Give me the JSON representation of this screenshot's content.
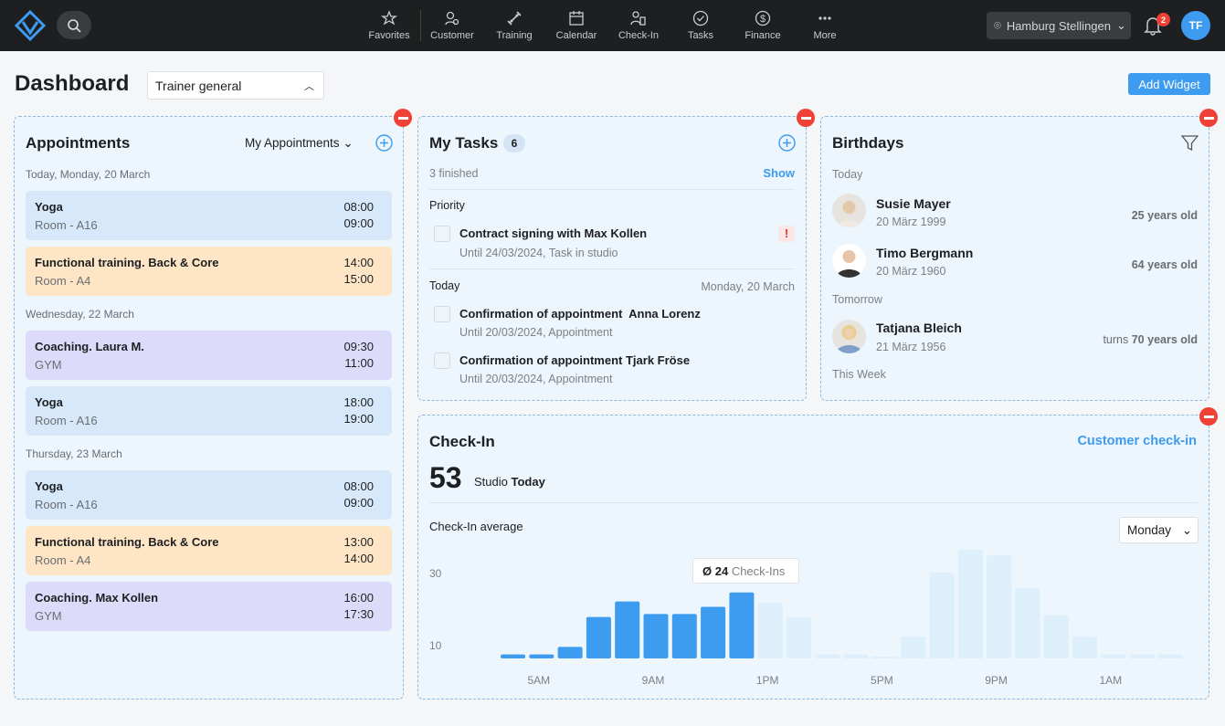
{
  "nav": {
    "items": [
      {
        "label": "Favorites",
        "icon": "star-icon"
      },
      {
        "label": "Customer",
        "icon": "customer-icon"
      },
      {
        "label": "Training",
        "icon": "dumbbell-icon"
      },
      {
        "label": "Calendar",
        "icon": "calendar-icon"
      },
      {
        "label": "Check-In",
        "icon": "checkin-icon"
      },
      {
        "label": "Tasks",
        "icon": "check-circle-icon"
      },
      {
        "label": "Finance",
        "icon": "dollar-icon"
      },
      {
        "label": "More",
        "icon": "more-icon"
      }
    ],
    "location": "Hamburg Stellingen",
    "notifications": "2",
    "user_initials": "TF"
  },
  "page": {
    "title": "Dashboard",
    "view_select": "Trainer general",
    "add_widget": "Add Widget"
  },
  "appointments": {
    "title": "Appointments",
    "filter": "My Appointments",
    "days": [
      {
        "label": "Today, Monday, 20 March",
        "items": [
          {
            "name": "Yoga",
            "room": "Room - A16",
            "start": "08:00",
            "end": "09:00",
            "color": "#d6e8fa"
          },
          {
            "name": "Functional training. Back & Core",
            "room": "Room - A4",
            "start": "14:00",
            "end": "15:00",
            "color": "#fde5c6"
          }
        ]
      },
      {
        "label": "Wednesday, 22 March",
        "items": [
          {
            "name": "Coaching. Laura M.",
            "room": "GYM",
            "start": "09:30",
            "end": "11:00",
            "color": "#dcdcfa"
          },
          {
            "name": "Yoga",
            "room": "Room - A16",
            "start": "18:00",
            "end": "19:00",
            "color": "#d6e8fa"
          }
        ]
      },
      {
        "label": "Thursday, 23 March",
        "items": [
          {
            "name": "Yoga",
            "room": "Room - A16",
            "start": "08:00",
            "end": "09:00",
            "color": "#d6e8fa"
          },
          {
            "name": "Functional training. Back & Core",
            "room": "Room - A4",
            "start": "13:00",
            "end": "14:00",
            "color": "#fde5c6"
          },
          {
            "name": "Coaching. Max Kollen",
            "room": "GYM",
            "start": "16:00",
            "end": "17:30",
            "color": "#dcdcfa"
          }
        ]
      }
    ]
  },
  "tasks": {
    "title": "My Tasks",
    "count": "6",
    "finished": "3 finished",
    "show": "Show",
    "priority_label": "Priority",
    "priority": [
      {
        "name": "Contract signing with Max Kollen",
        "sub": "Until 24/03/2024, Task in studio",
        "flag": "!"
      }
    ],
    "today_label": "Today",
    "today_date": "Monday, 20 March",
    "today": [
      {
        "name": "Confirmation of appointment  Anna Lorenz",
        "sub": "Until 20/03/2024, Appointment"
      },
      {
        "name": "Confirmation of appointment Tjark Fröse",
        "sub": "Until 20/03/2024, Appointment"
      }
    ]
  },
  "birthdays": {
    "title": "Birthdays",
    "today_label": "Today",
    "tomorrow_label": "Tomorrow",
    "week_label": "This Week",
    "people": [
      {
        "name": "Susie Mayer",
        "date": "20 März 1999",
        "age": "25 years old"
      },
      {
        "name": "Timo Bergmann",
        "date": "20 März 1960",
        "age": "64 years old"
      },
      {
        "name": "Tatjana Bleich",
        "date": "21 März 1956",
        "age_prefix": "turns",
        "age": "70 years old"
      }
    ]
  },
  "checkin": {
    "title": "Check-In",
    "link": "Customer check-in",
    "count": "53",
    "studio": "Studio",
    "today": "Today",
    "avg_label": "Check-In average",
    "day_select": "Monday",
    "tooltip_value": "Ø 24",
    "tooltip_label": "Check-Ins"
  },
  "chart_data": {
    "type": "bar",
    "title": "Check-In average",
    "ymin": 6.5,
    "yticks": [
      10,
      30
    ],
    "ytick_labels": [
      "10",
      "30"
    ],
    "categories": [
      "4AM",
      "5AM",
      "6AM",
      "7AM",
      "8AM",
      "9AM",
      "10AM",
      "11AM",
      "12PM",
      "1PM",
      "2PM",
      "3PM",
      "4PM",
      "5PM",
      "6PM",
      "7PM",
      "8PM",
      "9PM",
      "10PM",
      "11PM",
      "12AM",
      "1AM",
      "2AM",
      "3AM"
    ],
    "values": [
      7.6,
      7.6,
      9.7,
      18,
      22.3,
      18.8,
      18.8,
      20.8,
      24.8,
      22,
      18,
      7.6,
      7.6,
      7,
      12.5,
      30.3,
      36.6,
      35,
      26,
      18.5,
      12.5,
      7.6,
      7.6,
      7.6
    ],
    "highlighted_until": "12PM",
    "xtick_labels": [
      "5AM",
      "9AM",
      "1PM",
      "5PM",
      "9PM",
      "1AM"
    ],
    "colors": {
      "active": "#3d9bf0",
      "inactive": "#dcefFb"
    }
  }
}
